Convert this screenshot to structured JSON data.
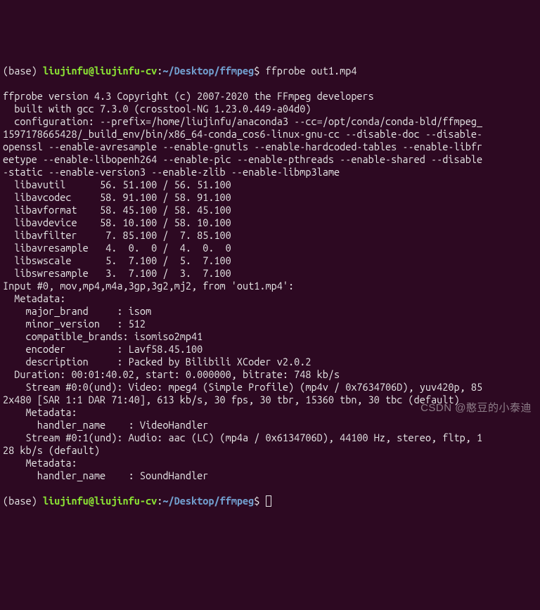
{
  "prompt1": {
    "base": "(base) ",
    "user": "liujinfu@liujinfu-cv",
    "colon": ":",
    "path": "~/Desktop/ffmpeg",
    "dollar": "$ ",
    "cmd": "ffprobe out1.mp4"
  },
  "lines": [
    "ffprobe version 4.3 Copyright (c) 2007-2020 the FFmpeg developers",
    "  built with gcc 7.3.0 (crosstool-NG 1.23.0.449-a04d0)",
    "  configuration: --prefix=/home/liujinfu/anaconda3 --cc=/opt/conda/conda-bld/ffmpeg_1597178665428/_build_env/bin/x86_64-conda_cos6-linux-gnu-cc --disable-doc --disable-openssl --enable-avresample --enable-gnutls --enable-hardcoded-tables --enable-libfreetype --enable-libopenh264 --enable-pic --enable-pthreads --enable-shared --disable-static --enable-version3 --enable-zlib --enable-libmp3lame",
    "  libavutil      56. 51.100 / 56. 51.100",
    "  libavcodec     58. 91.100 / 58. 91.100",
    "  libavformat    58. 45.100 / 58. 45.100",
    "  libavdevice    58. 10.100 / 58. 10.100",
    "  libavfilter     7. 85.100 /  7. 85.100",
    "  libavresample   4.  0.  0 /  4.  0.  0",
    "  libswscale      5.  7.100 /  5.  7.100",
    "  libswresample   3.  7.100 /  3.  7.100",
    "Input #0, mov,mp4,m4a,3gp,3g2,mj2, from 'out1.mp4':",
    "  Metadata:",
    "    major_brand     : isom",
    "    minor_version   : 512",
    "    compatible_brands: isomiso2mp41",
    "    encoder         : Lavf58.45.100",
    "    description     : Packed by Bilibili XCoder v2.0.2",
    "  Duration: 00:01:40.02, start: 0.000000, bitrate: 748 kb/s",
    "    Stream #0:0(und): Video: mpeg4 (Simple Profile) (mp4v / 0x7634706D), yuv420p, 852x480 [SAR 1:1 DAR 71:40], 613 kb/s, 30 fps, 30 tbr, 15360 tbn, 30 tbc (default)",
    "    Metadata:",
    "      handler_name    : VideoHandler",
    "    Stream #0:1(und): Audio: aac (LC) (mp4a / 0x6134706D), 44100 Hz, stereo, fltp, 128 kb/s (default)",
    "    Metadata:",
    "      handler_name    : SoundHandler"
  ],
  "prompt2": {
    "base": "(base) ",
    "user": "liujinfu@liujinfu-cv",
    "colon": ":",
    "path": "~/Desktop/ffmpeg",
    "dollar": "$ "
  },
  "watermark": "CSDN @憨豆的小泰迪"
}
